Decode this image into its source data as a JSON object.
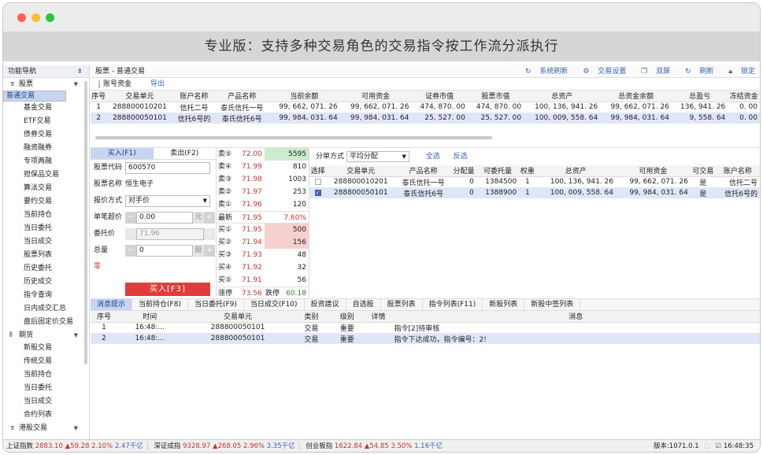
{
  "window": {
    "banner": "专业版：支持多种交易角色的交易指令按工作流分派执行"
  },
  "sidebar": {
    "title": "功能导航",
    "pin": "⇟",
    "g1": "股票",
    "g1_items": [
      "普通交易",
      "基金交易",
      "ETF交易",
      "债券交易",
      "融资融券",
      "专项两融",
      "担保品交易",
      "算法交易",
      "要约交易",
      "当前持仓",
      "当日委托",
      "当日成交",
      "股票列表",
      "历史委托",
      "历史成交",
      "指令查询",
      "日内成交汇总",
      "盘后固定价交易"
    ],
    "g2": "期货",
    "g2_items": [
      "新股交易",
      "传统交易",
      "当前持仓",
      "当日委托",
      "当日成交",
      "合约列表"
    ],
    "g3": "港股交易"
  },
  "toolbar": {
    "title": "股票 - 普通交易",
    "sync": "系统刷新",
    "settings": "交易设置",
    "dual": "双屏",
    "refresh": "刷新",
    "lock": "锁定",
    "tab_fund": "账号资金",
    "export": "导出"
  },
  "accounts": {
    "cols": [
      "序号",
      "交易单元",
      "账户名称",
      "产品名称",
      "当前余额",
      "可用资金",
      "证券市值",
      "股票市值",
      "总资产",
      "总资金余额",
      "总盈亏",
      "冻结资金"
    ],
    "rows": [
      [
        "1",
        "288800010201",
        "信托二号",
        "泰氏信托一号",
        "99, 662, 071. 26",
        "99, 662, 071. 26",
        "474, 870. 00",
        "474, 870. 00",
        "100, 136, 941. 26",
        "99, 662, 071. 26",
        "136, 941. 26",
        "0. 00"
      ],
      [
        "2",
        "288800050101",
        "信托6号的",
        "泰氏信托6号",
        "99, 984, 031. 64",
        "99, 984, 031. 64",
        "25, 527. 00",
        "25, 527. 00",
        "100, 009, 558. 64",
        "99, 984, 031. 64",
        "9, 558. 64",
        "0. 00"
      ]
    ]
  },
  "order": {
    "buy_tab": "买入(F1)",
    "sell_tab": "卖出(F2)",
    "code_lbl": "股票代码",
    "code": "600570",
    "name_lbl": "股票名称",
    "name": "恒生电子",
    "mode_lbl": "报价方式",
    "mode": "对手价",
    "single_lbl": "单笔超价",
    "single": "0.00",
    "single_unit": "元",
    "price_lbl": "委托价",
    "price": "71.96",
    "qty_lbl": "总量",
    "qty": "0",
    "qty_unit": "股",
    "zero": "零",
    "buy_btn": "买入[F3]",
    "minus": "−",
    "plus": "+"
  },
  "book": {
    "rows": [
      [
        "卖⑤",
        "72.00",
        "5595"
      ],
      [
        "卖④",
        "71.99",
        "810"
      ],
      [
        "卖③",
        "71.98",
        "1003"
      ],
      [
        "卖②",
        "71.97",
        "253"
      ],
      [
        "卖①",
        "71.96",
        "120"
      ],
      [
        "最新",
        "71.95",
        "7.60%"
      ],
      [
        "买①",
        "71.95",
        "500"
      ],
      [
        "买②",
        "71.94",
        "156"
      ],
      [
        "买③",
        "71.93",
        "48"
      ],
      [
        "买④",
        "71.92",
        "32"
      ],
      [
        "买⑤",
        "71.91",
        "56"
      ]
    ],
    "last": [
      "涨停",
      "73.56",
      "跌停",
      "60.18"
    ]
  },
  "dist": {
    "mode_lbl": "分单方式",
    "mode": "平均分配",
    "all": "全选",
    "inv": "反选",
    "cols": [
      "选择",
      "交易单元",
      "产品名称",
      "分配量",
      "可委托量",
      "权重",
      "总资产",
      "可用资金",
      "可交易",
      "账户名称"
    ],
    "rows": [
      [
        "288800010201",
        "泰氏信托一号",
        "0",
        "1384500",
        "1",
        "100, 136, 941. 26",
        "99, 662, 071. 26",
        "是",
        "信托二号"
      ],
      [
        "288800050101",
        "泰氏信托6号",
        "0",
        "1388900",
        "1",
        "100, 009, 558. 64",
        "99, 984, 031. 64",
        "是",
        "信托6号的"
      ]
    ]
  },
  "bottom": {
    "tabs": [
      "消息提示",
      "当前持仓(F8)",
      "当日委托(F9)",
      "当日成交(F10)",
      "投资建议",
      "自选股",
      "股票列表",
      "指令列表(F11)",
      "新股列表",
      "新股中签列表"
    ],
    "cols": [
      "序号",
      "时间",
      "交易单元",
      "类别",
      "级别",
      "详情",
      "消息"
    ],
    "rows": [
      [
        "1",
        "16:48:...",
        "288800050101",
        "交易",
        "重要",
        "",
        "指令[2]待审核"
      ],
      [
        "2",
        "16:48:...",
        "288800050101",
        "交易",
        "重要",
        "",
        "指令下达成功，指令编号：2!"
      ]
    ]
  },
  "status": {
    "sh": "上证指数",
    "sh_v": "2883.10",
    "sh_c": "▲59.28",
    "sh_p": "2.10%",
    "sh_a": "2.47千亿",
    "sz": "深证成指",
    "sz_v": "9328.97",
    "sz_c": "▲268.05",
    "sz_p": "2.96%",
    "sz_a": "3.35千亿",
    "cy": "创业板指",
    "cy_v": "1622.84",
    "cy_c": "▲54.85",
    "cy_p": "3.50%",
    "cy_a": "1.16千亿",
    "ver": "版本:1071.0.1",
    "time": "16:48:35"
  }
}
